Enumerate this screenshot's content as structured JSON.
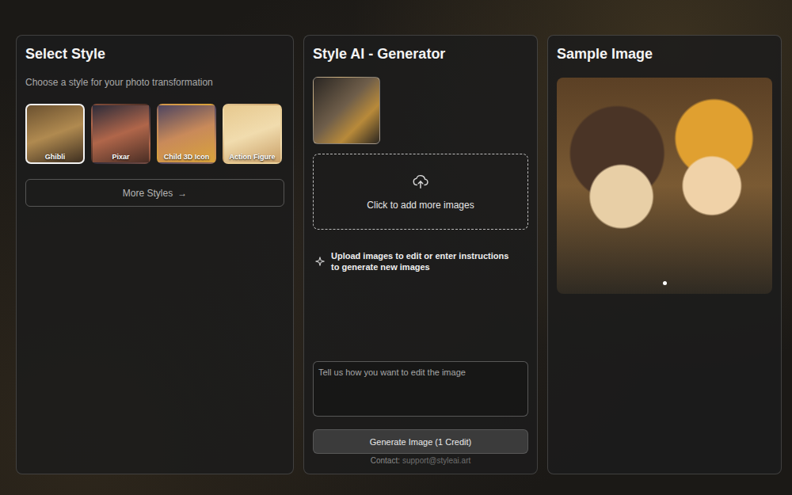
{
  "styles_panel": {
    "title": "Select Style",
    "subtitle": "Choose a style for your photo transformation",
    "styles": [
      {
        "label": "Ghibli",
        "selected": true
      },
      {
        "label": "Pixar",
        "selected": false
      },
      {
        "label": "Child 3D Icon",
        "selected": false
      },
      {
        "label": "Action Figure",
        "selected": false
      }
    ],
    "more_button": {
      "label": "More Styles",
      "arrow": "→"
    }
  },
  "generator": {
    "title": "Style AI - Generator",
    "upload_zone": {
      "label": "Click to add more images"
    },
    "hint": "Upload images to edit or enter instructions to generate new images",
    "prompt": {
      "placeholder": "Tell us how you want to edit the image",
      "value": ""
    },
    "generate_button": "Generate Image (1 Credit)",
    "contact": {
      "label": "Contact:",
      "email": "support@styleai.art"
    }
  },
  "sample": {
    "title": "Sample Image",
    "dots": [
      {
        "selected": true
      }
    ]
  }
}
